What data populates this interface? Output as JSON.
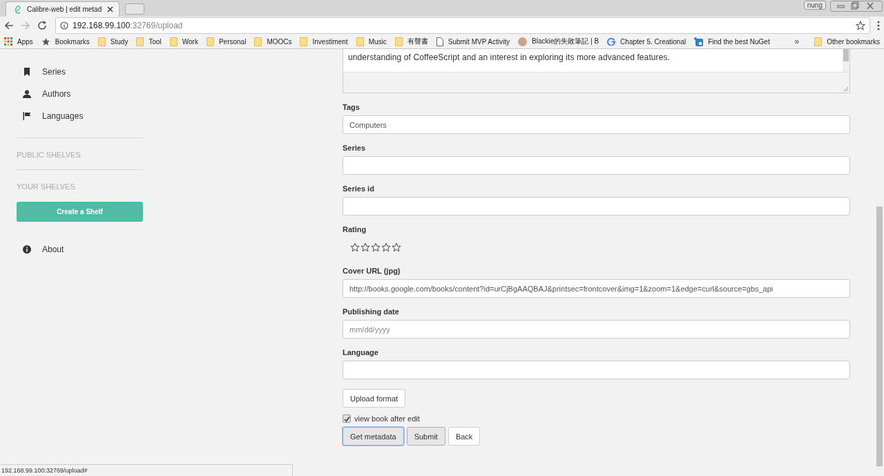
{
  "browser": {
    "tab": {
      "title": "Calibre-web | edit metad"
    },
    "profile": "nung",
    "address": {
      "host": "192.168.99.100",
      "rest": ":32769/upload"
    },
    "bookmarks": [
      {
        "kind": "apps",
        "label": "Apps"
      },
      {
        "kind": "star",
        "label": "Bookmarks"
      },
      {
        "kind": "folder",
        "label": "Study"
      },
      {
        "kind": "folder",
        "label": "Tool"
      },
      {
        "kind": "folder",
        "label": "Work"
      },
      {
        "kind": "folder",
        "label": "Personal"
      },
      {
        "kind": "folder",
        "label": "MOOCs"
      },
      {
        "kind": "folder",
        "label": "Investiment"
      },
      {
        "kind": "folder",
        "label": "Music"
      },
      {
        "kind": "folder",
        "label": "有聲書"
      },
      {
        "kind": "page",
        "label": "Submit MVP Activity"
      },
      {
        "kind": "avatar",
        "label": "Blackie的失敗筆記 | B"
      },
      {
        "kind": "google",
        "label": "Chapter 5. Creational"
      },
      {
        "kind": "nuget",
        "label": "Find the best NuGet"
      }
    ],
    "overflow": "»",
    "other": "Other bookmarks"
  },
  "sidebar": {
    "items": [
      {
        "kind": "bookmark",
        "label": "Series"
      },
      {
        "kind": "person",
        "label": "Authors"
      },
      {
        "kind": "flag",
        "label": "Languages"
      }
    ],
    "sections": [
      "PUBLIC SHELVES",
      "YOUR SHELVES"
    ],
    "create_button": "Create a Shelf",
    "about": "About"
  },
  "form": {
    "description_tail": "understanding of CoffeeScript and an interest in exploring its more advanced features.",
    "fields": [
      {
        "kind": "text",
        "label": "Tags",
        "value": "Computers"
      },
      {
        "kind": "text",
        "label": "Series"
      },
      {
        "kind": "text",
        "label": "Series id"
      },
      {
        "kind": "stars",
        "label": "Rating",
        "stars": 0
      },
      {
        "kind": "text",
        "label": "Cover URL (jpg)",
        "value": "http://books.google.com/books/content?id=urCjBgAAQBAJ&printsec=frontcover&img=1&zoom=1&edge=curl&source=gbs_api"
      },
      {
        "kind": "text",
        "label": "Publishing date",
        "placeholder": "mm/dd/yyyy"
      },
      {
        "kind": "text",
        "label": "Language"
      }
    ],
    "upload_button": "Upload format",
    "view_after_edit": {
      "label": "view book after edit",
      "checked": true
    },
    "buttons": [
      {
        "label": "Get metadata",
        "focused": true,
        "hovered": false
      },
      {
        "label": "Submit",
        "focused": false,
        "hovered": true
      },
      {
        "label": "Back",
        "focused": false,
        "hovered": false
      }
    ]
  },
  "status_bar": "192.168.99.100:32769/upload#"
}
